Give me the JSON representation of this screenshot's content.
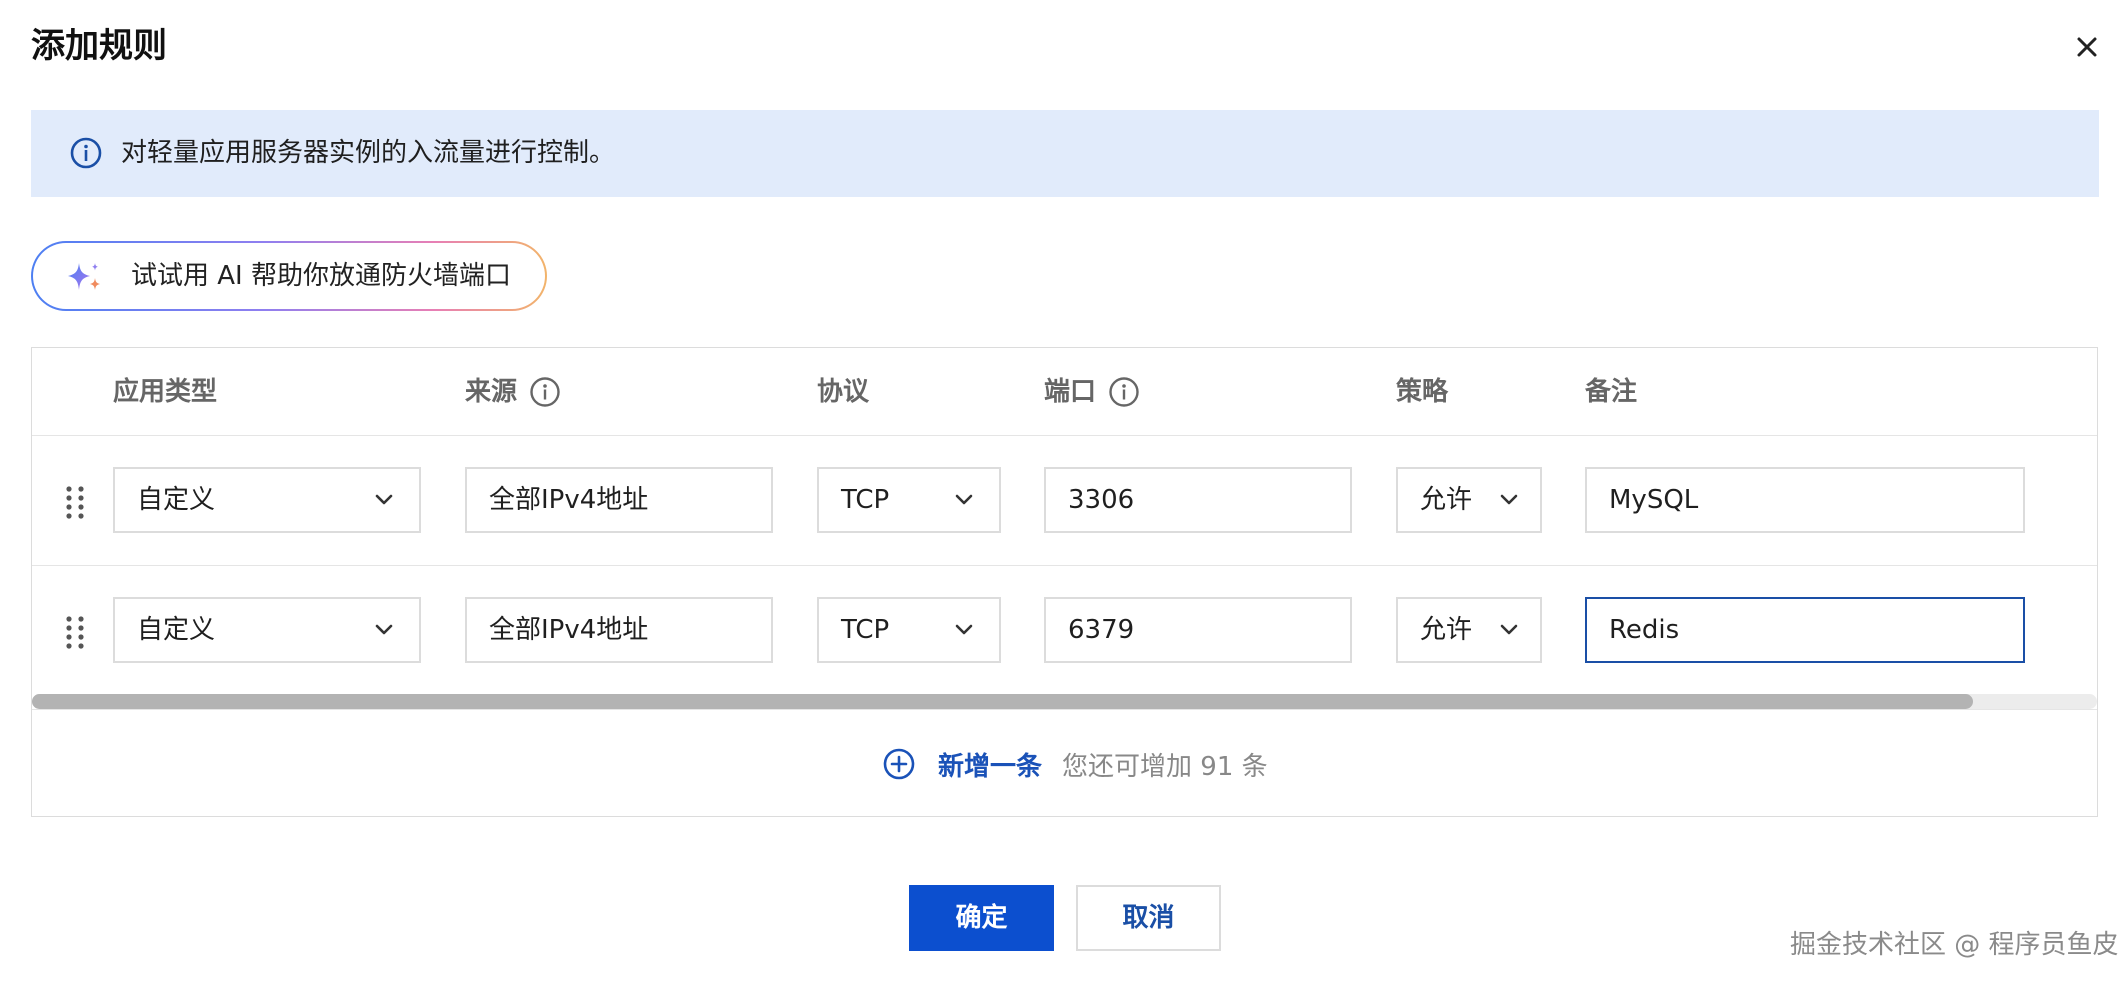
{
  "dialog": {
    "title": "添加规则"
  },
  "info": {
    "text": "对轻量应用服务器实例的入流量进行控制。"
  },
  "ai_button": {
    "label": "试试用 AI 帮助你放通防火墙端口"
  },
  "table": {
    "headers": {
      "app_type": "应用类型",
      "source": "来源",
      "protocol": "协议",
      "port": "端口",
      "policy": "策略",
      "remark": "备注"
    },
    "rows": [
      {
        "app_type": "自定义",
        "source": "全部IPv4地址",
        "protocol": "TCP",
        "port": "3306",
        "policy": "允许",
        "remark": "MySQL"
      },
      {
        "app_type": "自定义",
        "source": "全部IPv4地址",
        "protocol": "TCP",
        "port": "6379",
        "policy": "允许",
        "remark": "Redis"
      }
    ],
    "scroll_position_fraction": 0.94
  },
  "add_row": {
    "label": "新增一条",
    "hint": "您还可增加 91 条"
  },
  "footer": {
    "ok_label": "确定",
    "cancel_label": "取消"
  },
  "watermark": "掘金技术社区 @ 程序员鱼皮",
  "colors": {
    "primary": "#0c4fcf",
    "link": "#1a52b8",
    "banner_bg": "#e1ebfb",
    "focus_border": "#1a4fa6"
  },
  "icons": {
    "close": "close-icon",
    "info": "info-circle-icon",
    "ai": "sparkle-icon",
    "hint": "info-circle-icon",
    "drag": "drag-handle-icon",
    "chevron": "chevron-down-icon",
    "add": "plus-circle-icon"
  }
}
